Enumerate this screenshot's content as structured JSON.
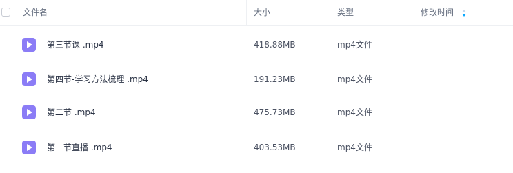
{
  "header": {
    "name_label": "文件名",
    "size_label": "大小",
    "type_label": "类型",
    "modified_label": "修改时间"
  },
  "files": [
    {
      "name": "第三节课 .mp4",
      "size": "418.88MB",
      "type": "mp4文件",
      "icon": "video-file-icon"
    },
    {
      "name": "第四节-学习方法梳理 .mp4",
      "size": "191.23MB",
      "type": "mp4文件",
      "icon": "video-file-icon"
    },
    {
      "name": "第二节 .mp4",
      "size": "475.73MB",
      "type": "mp4文件",
      "icon": "video-file-icon"
    },
    {
      "name": "第一节直播 .mp4",
      "size": "403.53MB",
      "type": "mp4文件",
      "icon": "video-file-icon"
    }
  ],
  "colors": {
    "icon_purple": "#8b7cf6",
    "sort_accent": "#06a7ff"
  }
}
